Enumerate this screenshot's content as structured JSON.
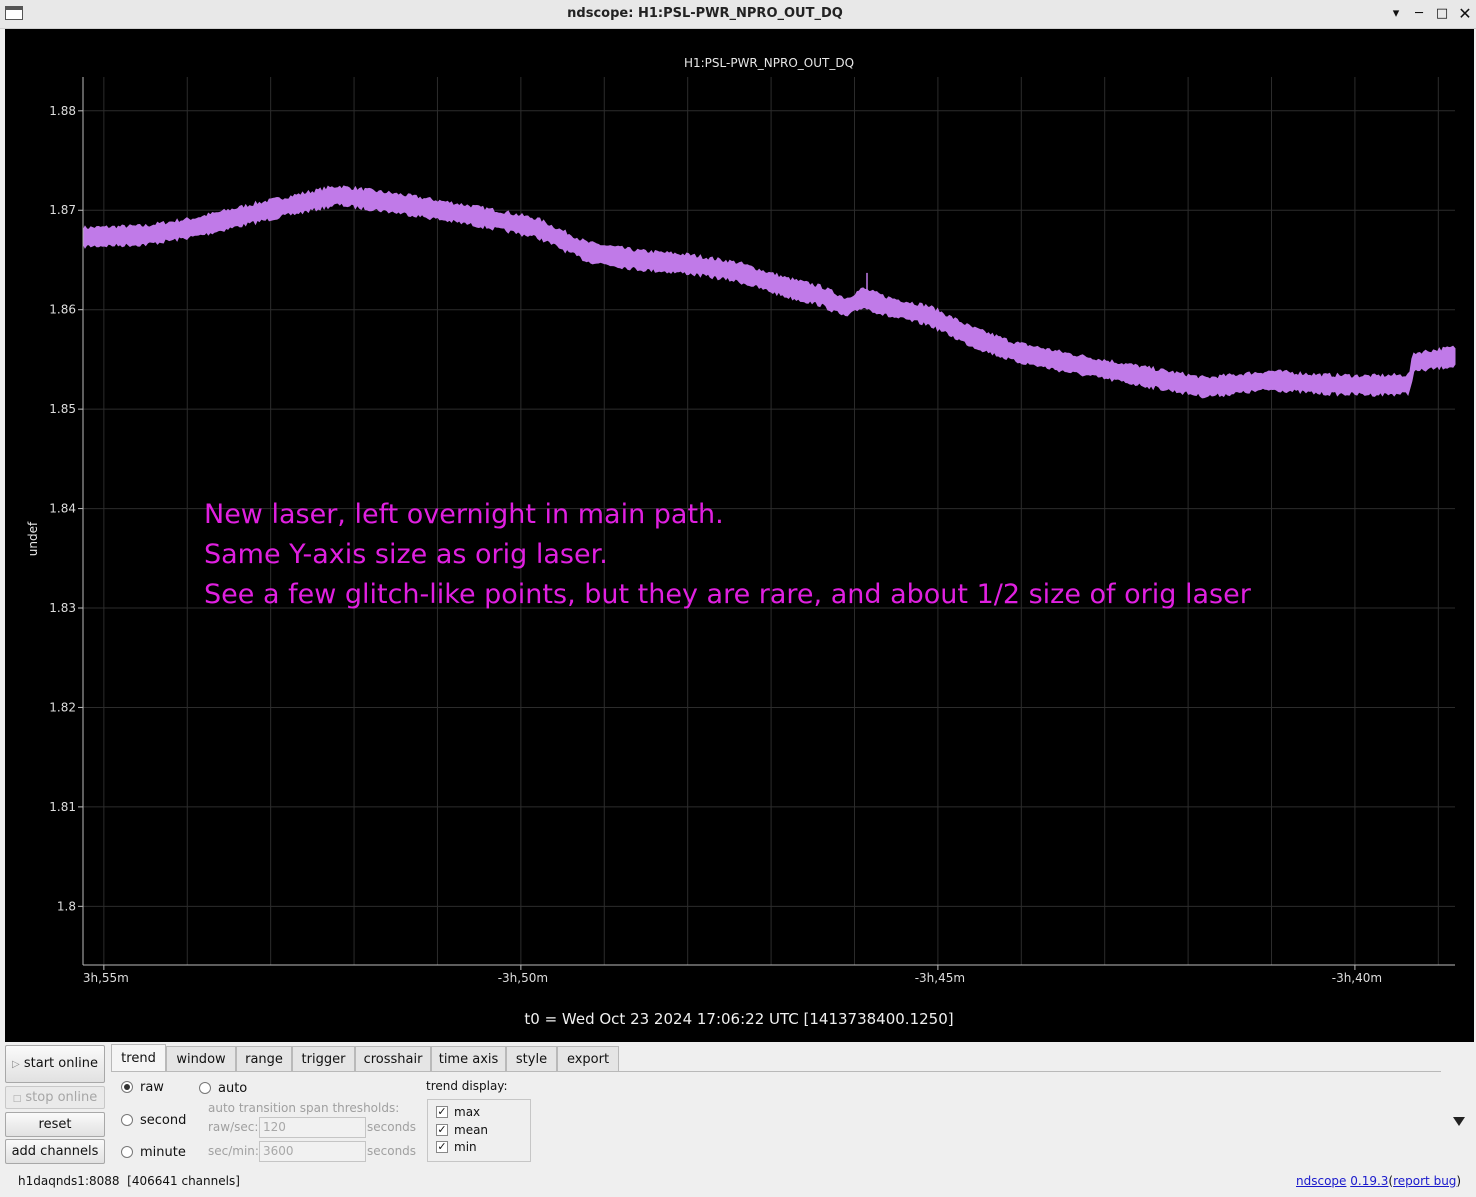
{
  "window": {
    "title": "ndscope: H1:PSL-PWR_NPRO_OUT_DQ",
    "controls": {
      "minimize_icon": "minimize-icon",
      "maximize_icon": "maximize-icon",
      "close_icon": "close-icon",
      "help_icon": "help-icon"
    }
  },
  "plot": {
    "channel_title": "H1:PSL-PWR_NPRO_OUT_DQ",
    "ylabel": "undef",
    "t0_label": "t0 = Wed Oct 23 2024 17:06:22 UTC [1413738400.1250]",
    "annotation": [
      "New laser, left overnight in main path.",
      "Same Y-axis size as orig laser.",
      "See a few glitch-like points, but they are rare, and about 1/2 size of orig laser"
    ],
    "colors": {
      "background": "#000000",
      "trace": "#c07ae8",
      "annotation": "#e020e0",
      "grid": "#2c2c2c",
      "axis_text": "#dddddd"
    }
  },
  "chart_data": {
    "type": "line",
    "title": "H1:PSL-PWR_NPRO_OUT_DQ",
    "ylabel": "undef",
    "xlabel": "t0 = Wed Oct 23 2024 17:06:22 UTC [1413738400.1250]",
    "x_unit": "minutes relative to t0",
    "xlim": [
      -235.25,
      -218.8
    ],
    "ylim": [
      1.7941,
      1.8834
    ],
    "x_ticks": [
      {
        "value": -235,
        "label": "3h,55m"
      },
      {
        "value": -230,
        "label": "-3h,50m"
      },
      {
        "value": -225,
        "label": "-3h,45m"
      },
      {
        "value": -220,
        "label": "-3h,40m"
      }
    ],
    "y_ticks": [
      1.8,
      1.81,
      1.82,
      1.83,
      1.84,
      1.85,
      1.86,
      1.87,
      1.88
    ],
    "y_tick_labels": [
      "1.8",
      "1.81",
      "1.82",
      "1.83",
      "1.84",
      "1.85",
      "1.86",
      "1.87",
      "1.88"
    ],
    "grid": true,
    "series": [
      {
        "x": [
          -235.25,
          -234.5,
          -233.9,
          -233.2,
          -232.2,
          -231.4,
          -230.6,
          -230.2,
          -229.8,
          -229.2,
          -228.6,
          -228.0,
          -227.4,
          -226.8,
          -226.4,
          -226.1,
          -225.9,
          -225.6,
          -225.1,
          -224.6,
          -224.1,
          -223.4,
          -222.6,
          -221.8,
          -221.0,
          -220.4,
          -219.8,
          -219.35,
          -219.3,
          -218.8
        ],
        "y": [
          1.8673,
          1.8675,
          1.8683,
          1.8697,
          1.8715,
          1.8706,
          1.8695,
          1.8689,
          1.8682,
          1.8658,
          1.865,
          1.8646,
          1.8638,
          1.8622,
          1.8614,
          1.8602,
          1.8612,
          1.8603,
          1.8594,
          1.8573,
          1.8558,
          1.8546,
          1.8534,
          1.8522,
          1.8529,
          1.8525,
          1.8524,
          1.8525,
          1.8547,
          1.8553
        ],
        "band_halfwidth": 0.0009
      }
    ],
    "glitches": [
      {
        "x": -225.85,
        "y_max": 1.8637
      }
    ]
  },
  "controls": {
    "start_online": "start online",
    "stop_online": "stop online",
    "reset": "reset",
    "add_channels": "add channels",
    "tabs": [
      "trend",
      "window",
      "range",
      "trigger",
      "crosshair",
      "time axis",
      "style",
      "export"
    ],
    "active_tab": "trend",
    "trend_modes": {
      "raw": "raw",
      "second": "second",
      "minute": "minute",
      "auto": "auto",
      "selected": "raw"
    },
    "auto_transition_label": "auto transition span thresholds:",
    "raw_sec_label": "raw/sec:",
    "raw_sec_value": "120",
    "sec_min_label": "sec/min:",
    "sec_min_value": "3600",
    "seconds_unit": "seconds",
    "trend_display_label": "trend display:",
    "trend_display": [
      {
        "label": "max",
        "checked": true
      },
      {
        "label": "mean",
        "checked": true
      },
      {
        "label": "min",
        "checked": true
      }
    ],
    "start_icon": "play-icon",
    "stop_icon": "stop-icon",
    "expand_icon": "triangle-down-icon"
  },
  "status": {
    "server": "h1daqnds1:8088",
    "channels": "[406641 channels]",
    "app_name": "ndscope",
    "version": "0.19.3",
    "paren_open": "(",
    "report_bug": "report bug",
    "paren_close": ")"
  }
}
